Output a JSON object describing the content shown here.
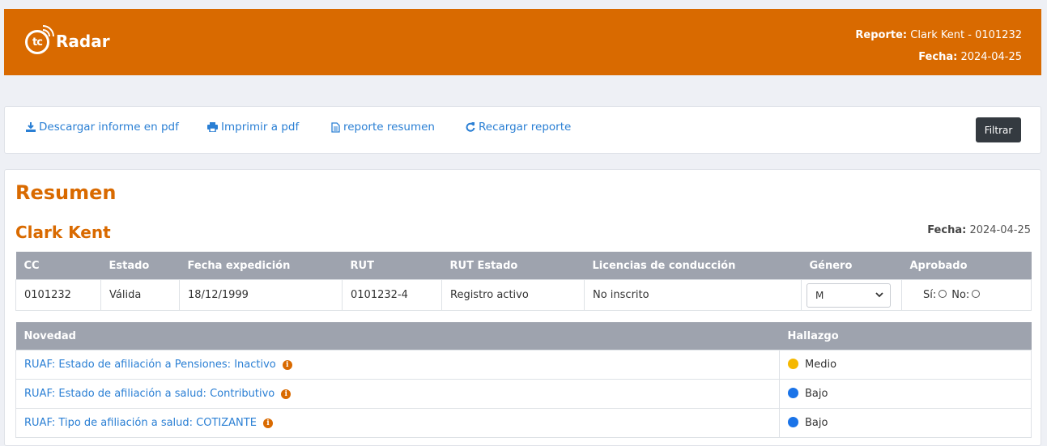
{
  "header": {
    "logo_text": "Radar",
    "logo_mark_text": "tc",
    "report_label": "Reporte:",
    "report_value": "Clark Kent - 0101232",
    "date_label": "Fecha:",
    "date_value": "2024-04-25",
    "color": "#d96a00"
  },
  "toolbar": {
    "download_label": "Descargar informe en pdf",
    "print_label": "Imprimir a pdf",
    "summary_label": "reporte resumen",
    "reload_label": "Recargar reporte",
    "filter_label": "Filtrar",
    "icons": [
      "download-icon",
      "print-icon",
      "document-icon",
      "refresh-icon"
    ]
  },
  "summary": {
    "title": "Resumen",
    "name": "Clark Kent",
    "date_label": "Fecha:",
    "date_value": "2024-04-25",
    "table": {
      "headers": [
        "CC",
        "Estado",
        "Fecha expedición",
        "RUT",
        "RUT Estado",
        "Licencias de conducción",
        "Género",
        "Aprobado"
      ],
      "row": {
        "cc": "0101232",
        "estado": "Válida",
        "fecha_expedicion": "18/12/1999",
        "rut": "0101232-4",
        "rut_estado": "Registro activo",
        "licencias": "No inscrito",
        "genero_selected": "M",
        "aprobado_si": "Sí:",
        "aprobado_no": "No:"
      }
    }
  },
  "novedades": {
    "headers": [
      "Novedad",
      "Hallazgo"
    ],
    "rows": [
      {
        "novedad": "RUAF: Estado de afiliación a Pensiones: Inactivo",
        "hallazgo": "Medio",
        "color": "#f5b800"
      },
      {
        "novedad": "RUAF: Estado de afiliación a salud: Contributivo",
        "hallazgo": "Bajo",
        "color": "#1a73e8"
      },
      {
        "novedad": "RUAF: Tipo de afiliación a salud: COTIZANTE",
        "hallazgo": "Bajo",
        "color": "#1a73e8"
      }
    ]
  }
}
